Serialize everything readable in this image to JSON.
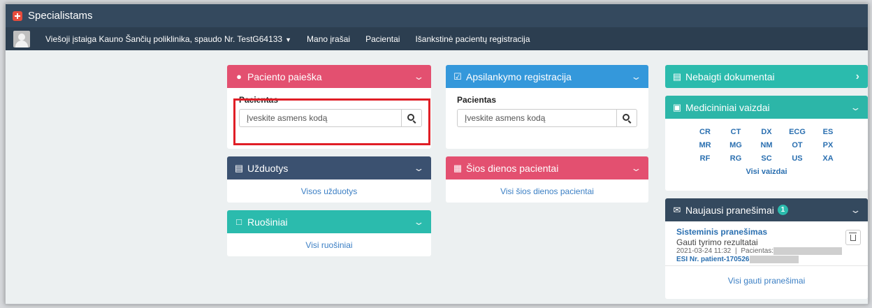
{
  "app": {
    "title": "Specialistams"
  },
  "nav": {
    "institution": "Viešoji įstaiga Kauno Šančių poliklinika, spaudo Nr. TestG64133",
    "items": [
      "Mano įrašai",
      "Pacientai",
      "Išankstinė pacientų registracija"
    ]
  },
  "patient_search": {
    "title": "Paciento paieška",
    "label": "Pacientas",
    "placeholder": "Įveskite asmens kodą"
  },
  "visit_registration": {
    "title": "Apsilankymo registracija",
    "label": "Pacientas",
    "placeholder": "Įveskite asmens kodą"
  },
  "tasks": {
    "title": "Užduotys",
    "link": "Visos užduotys"
  },
  "today_patients": {
    "title": "Šios dienos pacientai",
    "link": "Visi šios dienos pacientai"
  },
  "drafts": {
    "title": "Ruošiniai",
    "link": "Visi ruošiniai"
  },
  "unfinished_docs": {
    "title": "Nebaigti dokumentai"
  },
  "medical_images": {
    "title": "Medicininiai vaizdai",
    "modalities": [
      "CR",
      "CT",
      "DX",
      "ECG",
      "ES",
      "MR",
      "MG",
      "NM",
      "OT",
      "PX",
      "RF",
      "RG",
      "SC",
      "US",
      "XA"
    ],
    "link": "Visi vaizdai"
  },
  "messages": {
    "title": "Naujausi pranešimai",
    "count": "1",
    "item": {
      "title": "Sisteminis pranešimas",
      "subtitle": "Gauti tyrimo rezultatai",
      "date": "2021-03-24 11:32",
      "separator": "|",
      "patient_label": "Pacientas:",
      "esi": "ESI Nr. patient-170526"
    },
    "link": "Visi gauti pranešimai"
  },
  "colors": {
    "title_bar": "#34495e",
    "nav_bar": "#2c3e50",
    "red": "#e35070",
    "blue": "#3498db",
    "dark": "#3b5170",
    "teal": "#2bbbad",
    "highlight": "#e01e26"
  }
}
